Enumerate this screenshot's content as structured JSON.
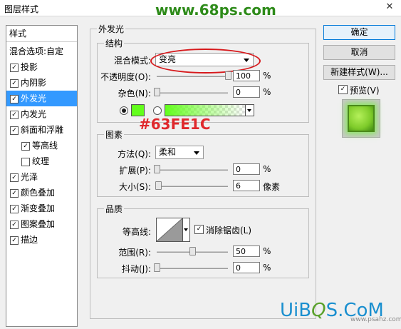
{
  "window": {
    "title": "图层样式",
    "close_glyph": "✕"
  },
  "watermark": {
    "top": "www.68ps.com",
    "bottom_site": "www.psahz.com",
    "logo_blue_left": "UiB",
    "logo_green": "Q",
    "logo_blue_right": "S.CoM"
  },
  "sidebar": {
    "header": "样式",
    "items": [
      {
        "label": "混合选项:自定",
        "checkbox": false,
        "checked": false
      },
      {
        "label": "投影",
        "checkbox": true,
        "checked": true
      },
      {
        "label": "内阴影",
        "checkbox": true,
        "checked": true
      },
      {
        "label": "外发光",
        "checkbox": true,
        "checked": true,
        "selected": true
      },
      {
        "label": "内发光",
        "checkbox": true,
        "checked": true
      },
      {
        "label": "斜面和浮雕",
        "checkbox": true,
        "checked": true
      },
      {
        "label": "等高线",
        "checkbox": true,
        "checked": true,
        "indent": true
      },
      {
        "label": "纹理",
        "checkbox": true,
        "checked": false,
        "indent": true
      },
      {
        "label": "光泽",
        "checkbox": true,
        "checked": true
      },
      {
        "label": "颜色叠加",
        "checkbox": true,
        "checked": true
      },
      {
        "label": "渐变叠加",
        "checkbox": true,
        "checked": true
      },
      {
        "label": "图案叠加",
        "checkbox": true,
        "checked": true
      },
      {
        "label": "描边",
        "checkbox": true,
        "checked": true
      }
    ],
    "check_glyph": "✓"
  },
  "main": {
    "group_title": "外发光",
    "structure": {
      "title": "结构",
      "blend_mode_label": "混合模式:",
      "blend_mode_value": "变亮",
      "opacity_label": "不透明度(O):",
      "opacity_value": "100",
      "opacity_level": 1.0,
      "noise_label": "杂色(N):",
      "noise_value": "0",
      "noise_level": 0.0,
      "percent": "%",
      "glow_color": "#63FE1C"
    },
    "annotation": "#63FE1C",
    "elements": {
      "title": "图素",
      "method_label": "方法(Q):",
      "method_value": "柔和",
      "spread_label": "扩展(P):",
      "spread_value": "0",
      "spread_level": 0.0,
      "size_label": "大小(S):",
      "size_value": "6",
      "size_unit": "像素",
      "size_level": 0.024,
      "percent": "%"
    },
    "quality": {
      "title": "品质",
      "contour_label": "等高线:",
      "antialias_label": "消除锯齿(L)",
      "antialias_checked": true,
      "range_label": "范围(R):",
      "range_value": "50",
      "range_level": 0.5,
      "jitter_label": "抖动(J):",
      "jitter_value": "0",
      "jitter_level": 0.0,
      "percent": "%"
    }
  },
  "buttons": {
    "ok": "确定",
    "cancel": "取消",
    "new_style": "新建样式(W)...",
    "preview_label": "预览(V)",
    "preview_checked": true
  },
  "colors": {
    "accent_selected": "#3399ff",
    "glow": "#63FE1C",
    "annotation_red": "#e0282c",
    "preview_green": "#7ecb2a"
  }
}
